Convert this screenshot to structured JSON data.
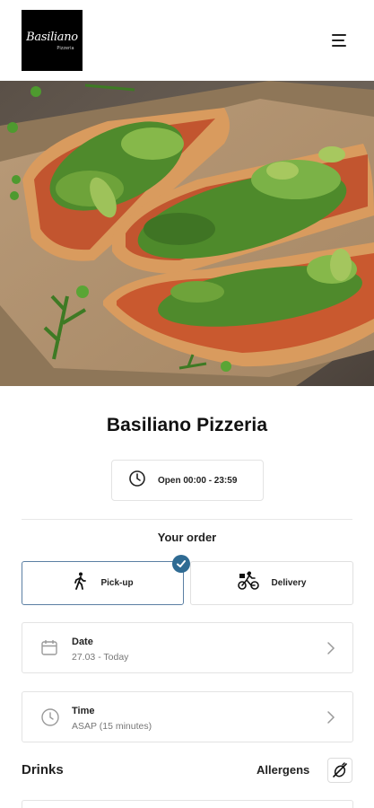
{
  "header": {
    "logo": {
      "name": "Basiliano",
      "sub": "Pizzeria"
    },
    "menu_icon": "hamburger-menu-icon"
  },
  "hero": {
    "image": "pizza-photo"
  },
  "restaurant": {
    "name": "Basiliano Pizzeria",
    "hours": "Open 00:00 - 23:59",
    "hours_icon": "clock-icon"
  },
  "order": {
    "heading": "Your order",
    "options": [
      {
        "label": "Pick-up",
        "icon": "walking-person-icon",
        "selected": true
      },
      {
        "label": "Delivery",
        "icon": "bicycle-courier-icon",
        "selected": false
      }
    ],
    "date": {
      "label": "Date",
      "value": "27.03 - Today",
      "icon": "calendar-icon"
    },
    "time": {
      "label": "Time",
      "value": "ASAP (15 minutes)",
      "icon": "clock-icon"
    }
  },
  "menu": {
    "section_title": "Drinks",
    "allergens_label": "Allergens",
    "allergens_icon": "no-allergen-icon"
  },
  "colors": {
    "accent": "#2f6b93",
    "selected_border": "#5b7fa3",
    "text": "#1a1a1a",
    "muted": "#777777",
    "border": "#e3e3e3"
  }
}
